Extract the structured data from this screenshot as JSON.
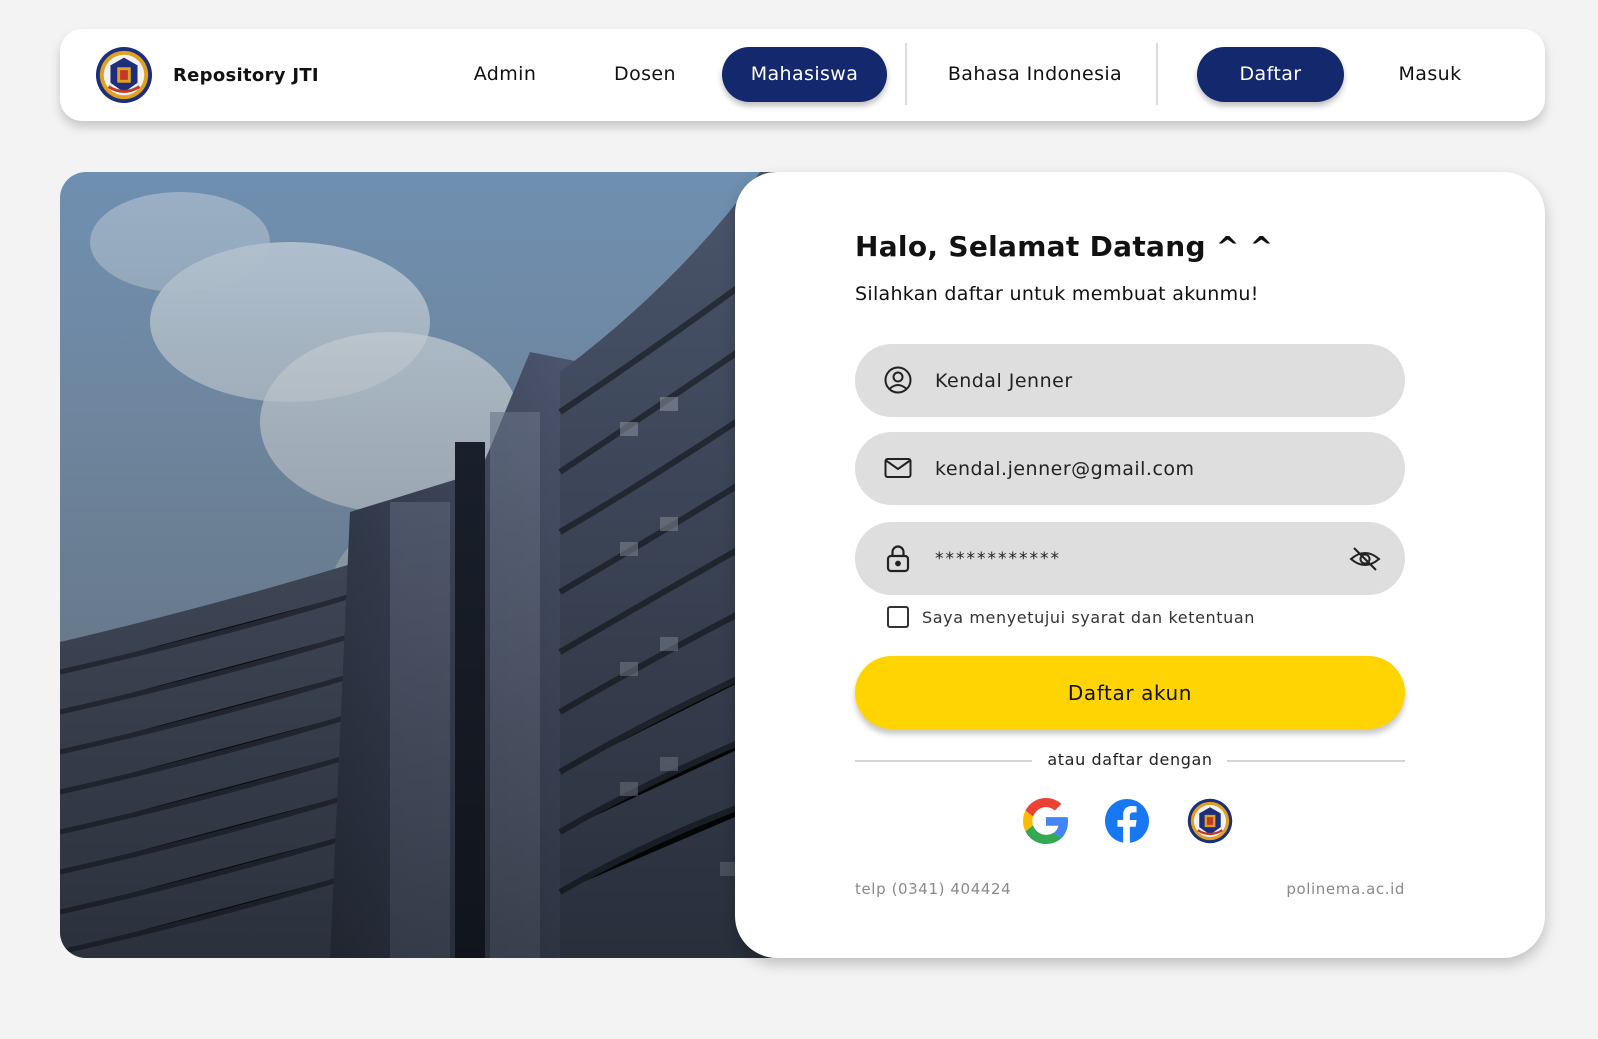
{
  "navbar": {
    "brand_name": "Repository JTI",
    "logo_icon": "polinema-logo",
    "items": [
      {
        "label": "Admin",
        "active": false
      },
      {
        "label": "Dosen",
        "active": false
      },
      {
        "label": "Mahasiswa",
        "active": true
      }
    ],
    "language": "Bahasa Indonesia",
    "register_label": "Daftar",
    "login_label": "Masuk"
  },
  "colors": {
    "primary": "#14286e",
    "accent": "#ffd400",
    "field_bg": "#dedede",
    "page_bg": "#f3f3f3"
  },
  "form": {
    "title": "Halo, Selamat Datang ^ ^",
    "subtitle": "Silahkan daftar untuk membuat akunmu!",
    "name": {
      "icon": "user-circle-icon",
      "value": "Kendal Jenner"
    },
    "email": {
      "icon": "mail-icon",
      "value": "kendal.jenner@gmail.com"
    },
    "password": {
      "icon": "lock-icon",
      "value": "************",
      "toggle_icon": "eye-off-icon"
    },
    "terms_label": "Saya menyetujui syarat dan ketentuan",
    "terms_checked": false,
    "submit_label": "Daftar akun",
    "divider_label": "atau daftar dengan",
    "social": [
      {
        "name": "google-icon"
      },
      {
        "name": "facebook-icon"
      },
      {
        "name": "polinema-logo"
      }
    ]
  },
  "footer": {
    "phone": "telp (0341) 404424",
    "website": "polinema.ac.id"
  }
}
